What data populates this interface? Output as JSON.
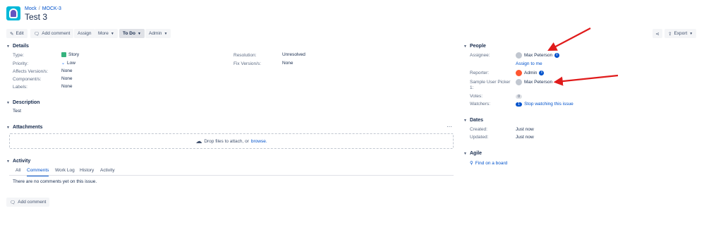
{
  "breadcrumb": {
    "project": "Mock",
    "issue_key": "MOCK-3"
  },
  "issue": {
    "title": "Test 3"
  },
  "toolbar": {
    "edit": "Edit",
    "add_comment": "Add comment",
    "assign": "Assign",
    "more": "More",
    "status": "To Do",
    "admin": "Admin",
    "export": "Export"
  },
  "details": {
    "heading": "Details",
    "type_label": "Type:",
    "type_value": "Story",
    "priority_label": "Priority:",
    "priority_value": "Low",
    "affects_label": "Affects Version/s:",
    "affects_value": "None",
    "components_label": "Component/s:",
    "components_value": "None",
    "labels_label": "Labels:",
    "labels_value": "None",
    "resolution_label": "Resolution:",
    "resolution_value": "Unresolved",
    "fix_label": "Fix Version/s:",
    "fix_value": "None"
  },
  "description": {
    "heading": "Description",
    "text": "Test"
  },
  "attachments": {
    "heading": "Attachments",
    "more": "···",
    "drop_text": "Drop files to attach, or",
    "browse": "browse."
  },
  "activity": {
    "heading": "Activity",
    "tabs": [
      "All",
      "Comments",
      "Work Log",
      "History",
      "Activity"
    ],
    "empty": "There are no comments yet on this issue.",
    "add_comment": "Add comment"
  },
  "people": {
    "heading": "People",
    "assignee_label": "Assignee:",
    "assignee": "Max Peterson",
    "assign_to_me": "Assign to me",
    "reporter_label": "Reporter:",
    "reporter": "Admin",
    "picker_label_1": "Sample User Picker",
    "picker_label_2": "1:",
    "picker_value": "Max Peterson",
    "votes_label": "Votes:",
    "votes": "0",
    "watchers_label": "Watchers:",
    "watchers": "1",
    "stop_watching": "Stop watching this issue"
  },
  "dates": {
    "heading": "Dates",
    "created_label": "Created:",
    "created": "Just now",
    "updated_label": "Updated:",
    "updated": "Just now"
  },
  "agile": {
    "heading": "Agile",
    "find_board": "Find on a board"
  },
  "colors": {
    "link": "#0052cc",
    "arrow": "#e01b1b",
    "text": "#172b4d",
    "muted": "#5e6c84"
  },
  "icons": [
    "project-avatar-icon",
    "edit-icon",
    "comment-icon",
    "caret-down-icon",
    "share-icon",
    "export-icon",
    "chevron-down-icon",
    "story-icon",
    "priority-low-icon",
    "upload-cloud-icon",
    "info-icon",
    "user-avatar-icon",
    "search-icon",
    "red-arrow-annotation"
  ]
}
